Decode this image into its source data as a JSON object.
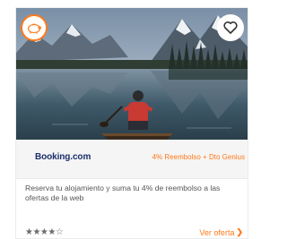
{
  "card": {
    "brand": "Booking.com",
    "offer": "4% Reembolso + Dto Genius",
    "description": "Reserva tu alojamiento y suma tu 4% de reembolso a las ofertas de la web",
    "rating_stars": "★★★★☆",
    "rating_value": 4,
    "rating_max": 5,
    "cta_label": "Ver oferta",
    "cta_chevron": "❯"
  },
  "icons": {
    "badge": "piggy-bank-icon",
    "favorite": "heart-outline-icon"
  },
  "colors": {
    "accent": "#ff7a1a",
    "brand": "#1a2f6b",
    "text": "#555555"
  }
}
